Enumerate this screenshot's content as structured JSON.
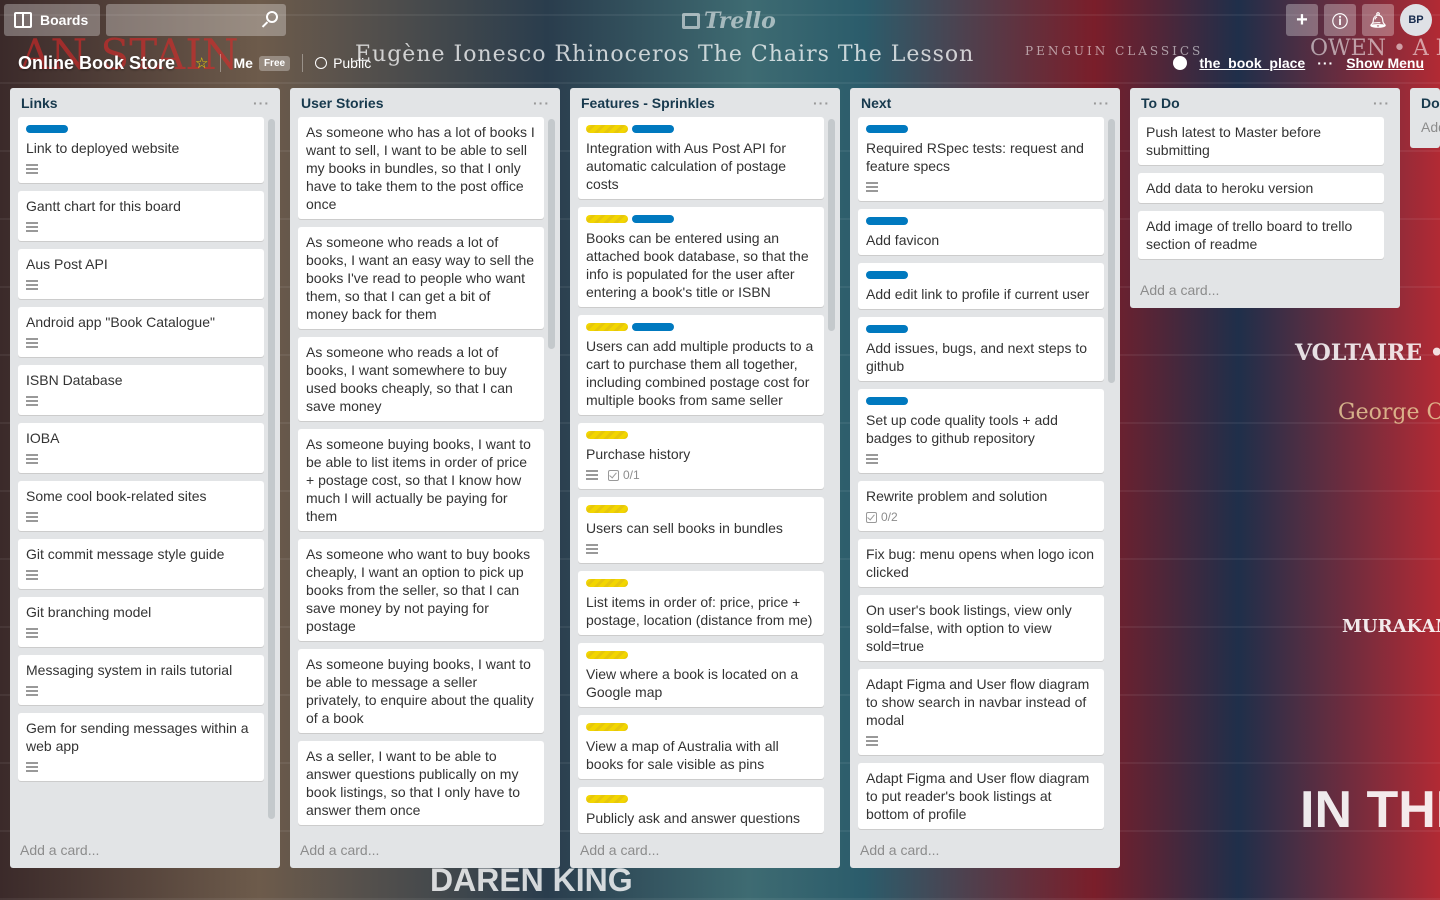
{
  "topbar": {
    "boards_label": "Boards",
    "logo_text": "Trello",
    "avatar_initials": "BP"
  },
  "board": {
    "title": "Online Book Store",
    "me_label": "Me",
    "plan_badge": "Free",
    "visibility": "Public",
    "repo_link": "the_book_place",
    "show_menu": "Show Menu"
  },
  "background_text": {
    "spine1": "Eugène Ionesco Rhinoceros The Chairs The Lesson",
    "spine2": "PENGUIN CLASSICS",
    "spine3": "OWEN • A N",
    "spine4": "VOLTAIRE • C",
    "spine5": "George O",
    "spine6": "MURAKAM",
    "spine7": "IN THE",
    "spine8": "DAREN KING",
    "spine9": "AN STAIN"
  },
  "lists": [
    {
      "title": "Links",
      "add_card": "Add a card...",
      "cards": [
        {
          "text": "Link to deployed website",
          "labels": [
            "blue"
          ],
          "desc": true
        },
        {
          "text": "Gantt chart for this board",
          "labels": [],
          "desc": true
        },
        {
          "text": "Aus Post API",
          "labels": [],
          "desc": true
        },
        {
          "text": "Android app \"Book Catalogue\"",
          "labels": [],
          "desc": true
        },
        {
          "text": "ISBN Database",
          "labels": [],
          "desc": true
        },
        {
          "text": "IOBA",
          "labels": [],
          "desc": true
        },
        {
          "text": "Some cool book-related sites",
          "labels": [],
          "desc": true
        },
        {
          "text": "Git commit message style guide",
          "labels": [],
          "desc": true
        },
        {
          "text": "Git branching model",
          "labels": [],
          "desc": true
        },
        {
          "text": "Messaging system in rails tutorial",
          "labels": [],
          "desc": true
        },
        {
          "text": "Gem for sending messages within a web app",
          "labels": [],
          "desc": true
        }
      ]
    },
    {
      "title": "User Stories",
      "add_card": "Add a card...",
      "cards": [
        {
          "text": "As someone who has a lot of books I want to sell, I want to be able to sell my books in bundles, so that I only have to take them to the post office once",
          "labels": [],
          "desc": false
        },
        {
          "text": "As someone who reads a lot of books, I want an easy way to sell the books I've read to people who want them, so that I can get a bit of money back for them",
          "labels": [],
          "desc": false
        },
        {
          "text": "As someone who reads a lot of books, I want somewhere to buy used books cheaply, so that I can save money",
          "labels": [],
          "desc": false
        },
        {
          "text": "As someone buying books, I want to be able to list items in order of price + postage cost, so that I know how much I will actually be paying for them",
          "labels": [],
          "desc": false
        },
        {
          "text": "As someone who want to buy books cheaply, I want an option to pick up books from the seller, so that I can save money by not paying for postage",
          "labels": [],
          "desc": false
        },
        {
          "text": "As someone buying books, I want to be able to message a seller privately, to enquire about the quality of a book",
          "labels": [],
          "desc": false
        },
        {
          "text": "As a seller, I want to be able to answer questions publically on my book listings, so that I only have to answer them once",
          "labels": [],
          "desc": false
        }
      ]
    },
    {
      "title": "Features - Sprinkles",
      "add_card": "Add a card...",
      "cards": [
        {
          "text": "Integration with Aus Post API for automatic calculation of postage costs",
          "labels": [
            "yellow",
            "blue"
          ],
          "desc": false
        },
        {
          "text": "Books can be entered using an attached book database, so that the info is populated for the user after entering a book's title or ISBN",
          "labels": [
            "yellow",
            "blue"
          ],
          "desc": false
        },
        {
          "text": "Users can add multiple products to a cart to purchase them all together, including combined postage cost for multiple books from same seller",
          "labels": [
            "yellow",
            "blue"
          ],
          "desc": false
        },
        {
          "text": "Purchase history",
          "labels": [
            "yellow"
          ],
          "desc": true,
          "checklist": "0/1"
        },
        {
          "text": "Users can sell books in bundles",
          "labels": [
            "yellow"
          ],
          "desc": true
        },
        {
          "text": "List items in order of: price, price + postage, location (distance from me)",
          "labels": [
            "yellow"
          ],
          "desc": false
        },
        {
          "text": "View where a book is located on a Google map",
          "labels": [
            "yellow"
          ],
          "desc": false
        },
        {
          "text": "View a map of Australia with all books for sale visible as pins",
          "labels": [
            "yellow"
          ],
          "desc": false
        },
        {
          "text": "Publicly ask and answer questions",
          "labels": [
            "yellow"
          ],
          "desc": false
        }
      ]
    },
    {
      "title": "Next",
      "add_card": "Add a card...",
      "cards": [
        {
          "text": "Required RSpec tests: request and feature specs",
          "labels": [
            "blue"
          ],
          "desc": true
        },
        {
          "text": "Add favicon",
          "labels": [
            "blue"
          ],
          "desc": false
        },
        {
          "text": "Add edit link to profile if current user",
          "labels": [
            "blue"
          ],
          "desc": false
        },
        {
          "text": "Add issues, bugs, and next steps to github",
          "labels": [
            "blue"
          ],
          "desc": false
        },
        {
          "text": "Set up code quality tools + add badges to github repository",
          "labels": [
            "blue"
          ],
          "desc": true
        },
        {
          "text": "Rewrite problem and solution",
          "labels": [],
          "desc": false,
          "checklist": "0/2"
        },
        {
          "text": "Fix bug: menu opens when logo icon clicked",
          "labels": [],
          "desc": false
        },
        {
          "text": "On user's book listings, view only sold=false, with option to view sold=true",
          "labels": [],
          "desc": false
        },
        {
          "text": "Adapt Figma and User flow diagram to show search in navbar instead of modal",
          "labels": [],
          "desc": true
        },
        {
          "text": "Adapt Figma and User flow diagram to put reader's book listings at bottom of profile",
          "labels": [],
          "desc": false
        }
      ]
    },
    {
      "title": "To Do",
      "add_card": "Add a card...",
      "cards": [
        {
          "text": "Push latest to Master before submitting",
          "labels": [],
          "desc": false
        },
        {
          "text": "Add data to heroku version",
          "labels": [],
          "desc": false
        },
        {
          "text": "Add image of trello board to trello section of readme",
          "labels": [],
          "desc": false
        }
      ]
    }
  ],
  "partial_list": {
    "title": "Do",
    "add_card": "Add"
  },
  "colors": {
    "label_blue": "#0079bf",
    "label_yellow": "#f2d600",
    "list_bg": "#e2e4e6"
  }
}
